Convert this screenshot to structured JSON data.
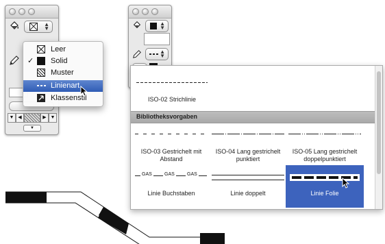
{
  "left_palette": {
    "menu": {
      "items": [
        {
          "label": "Leer",
          "icon": "empty-box-icon",
          "checked": false,
          "selected": false
        },
        {
          "label": "Solid",
          "icon": "solid-fill-icon",
          "checked": true,
          "selected": false
        },
        {
          "label": "Muster",
          "icon": "pattern-fill-icon",
          "checked": false,
          "selected": false
        },
        {
          "label": "Linienart",
          "icon": "dashed-line-icon",
          "checked": false,
          "selected": true
        },
        {
          "label": "Klassenstil",
          "icon": "class-style-icon",
          "checked": false,
          "selected": false
        }
      ],
      "check_glyph": "✓"
    }
  },
  "gallery": {
    "top_item_label": "ISO-02 Strichlinie",
    "section_header": "Bibliotheksvorgaben",
    "row1": [
      {
        "label_line1": "ISO-03 Gestrichelt mit",
        "label_line2": "Abstand"
      },
      {
        "label_line1": "ISO-04 Lang gestrichelt",
        "label_line2": "punktiert"
      },
      {
        "label_line1": "ISO-05 Lang gestrichelt",
        "label_line2": "doppelpunktiert"
      }
    ],
    "row2": [
      {
        "label": "Linie Buchstaben",
        "gas_text": "GAS"
      },
      {
        "label": "Linie doppelt"
      },
      {
        "label": "Linie Folie",
        "selected": true
      }
    ]
  },
  "colors": {
    "selection": "#3d63bd",
    "menu_highlight": "#2f5cb5",
    "section_header_bg": "#b3b3b3"
  }
}
